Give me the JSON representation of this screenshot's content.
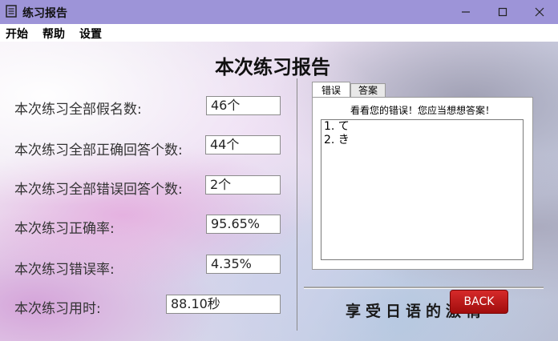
{
  "window": {
    "title": "练习报告",
    "titlebar_color": "#9d94d8",
    "icons": {
      "app": "notepad-icon",
      "minimize": "minimize-icon",
      "maximize": "maximize-icon",
      "close": "close-icon"
    }
  },
  "menu": {
    "items": [
      "开始",
      "帮助",
      "设置"
    ]
  },
  "main": {
    "title": "本次练习报告",
    "stats": [
      {
        "label": "本次练习全部假名数:",
        "value": "46个"
      },
      {
        "label": "本次练习全部正确回答个数:",
        "value": "44个"
      },
      {
        "label": "本次练习全部错误回答个数:",
        "value": "2个"
      },
      {
        "label": "本次练习正确率:",
        "value": "95.65%"
      },
      {
        "label": "本次练习错误率:",
        "value": "4.35%"
      },
      {
        "label": "本次练习用时:",
        "value": "88.10秒"
      }
    ]
  },
  "tabs": {
    "items": [
      "错误",
      "答案"
    ],
    "active": "错误"
  },
  "errors_panel": {
    "hint": "看看您的错误！您应当想想答案！",
    "items": [
      "1. て",
      "2. き"
    ]
  },
  "footer": {
    "slogan": "享受日语的激情",
    "back_label": "BACK",
    "back_color": "#c31818"
  }
}
